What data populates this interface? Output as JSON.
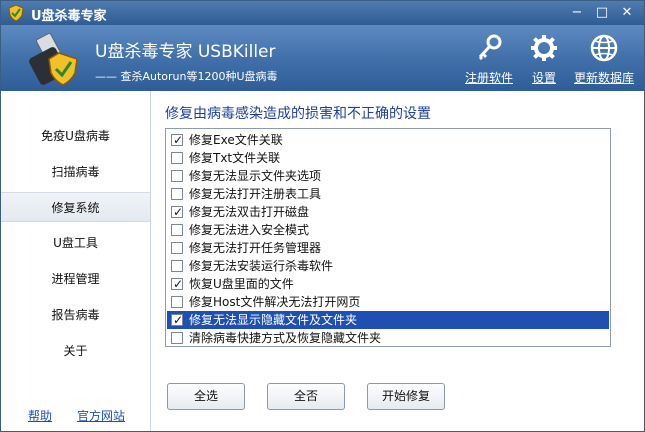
{
  "window": {
    "title": "U盘杀毒专家",
    "controls": {
      "minimize": "−",
      "maximize": "□",
      "close": "✕"
    }
  },
  "header": {
    "title": "U盘杀毒专家    USBKiller",
    "subtitle": "—— 查杀Autorun等1200种U盘病毒",
    "buttons": [
      {
        "label": "注册软件",
        "icon": "key-icon"
      },
      {
        "label": "设置",
        "icon": "gear-icon"
      },
      {
        "label": "更新数据库",
        "icon": "globe-icon"
      }
    ]
  },
  "sidebar": {
    "items": [
      {
        "label": "免疫U盘病毒",
        "active": false
      },
      {
        "label": "扫描病毒",
        "active": false
      },
      {
        "label": "修复系统",
        "active": true
      },
      {
        "label": "U盘工具",
        "active": false
      },
      {
        "label": "进程管理",
        "active": false
      },
      {
        "label": "报告病毒",
        "active": false
      },
      {
        "label": "关于",
        "active": false
      }
    ],
    "footer": {
      "help": "帮助",
      "site": "官方网站"
    }
  },
  "main": {
    "title": "修复由病毒感染造成的损害和不正确的设置",
    "options": [
      {
        "label": "修复Exe文件关联",
        "checked": true
      },
      {
        "label": "修复Txt文件关联",
        "checked": false
      },
      {
        "label": "修复无法显示文件夹选项",
        "checked": false
      },
      {
        "label": "修复无法打开注册表工具",
        "checked": false
      },
      {
        "label": "修复无法双击打开磁盘",
        "checked": true
      },
      {
        "label": "修复无法进入安全模式",
        "checked": false
      },
      {
        "label": "修复无法打开任务管理器",
        "checked": false
      },
      {
        "label": "修复无法安装运行杀毒软件",
        "checked": false
      },
      {
        "label": "恢复U盘里面的文件",
        "checked": true
      },
      {
        "label": "修复Host文件解决无法打开网页",
        "checked": false
      },
      {
        "label": "修复无法显示隐藏文件及文件夹",
        "checked": true,
        "selected": true
      },
      {
        "label": "清除病毒快捷方式及恢复隐藏文件夹",
        "checked": false
      }
    ],
    "buttons": {
      "select_all": "全选",
      "select_none": "全否",
      "start": "开始修复"
    }
  },
  "colors": {
    "title_bar": "#2f5c94",
    "header": "#3f6ea8",
    "selection": "#1f4fb3",
    "section_title": "#1f3f9e"
  }
}
